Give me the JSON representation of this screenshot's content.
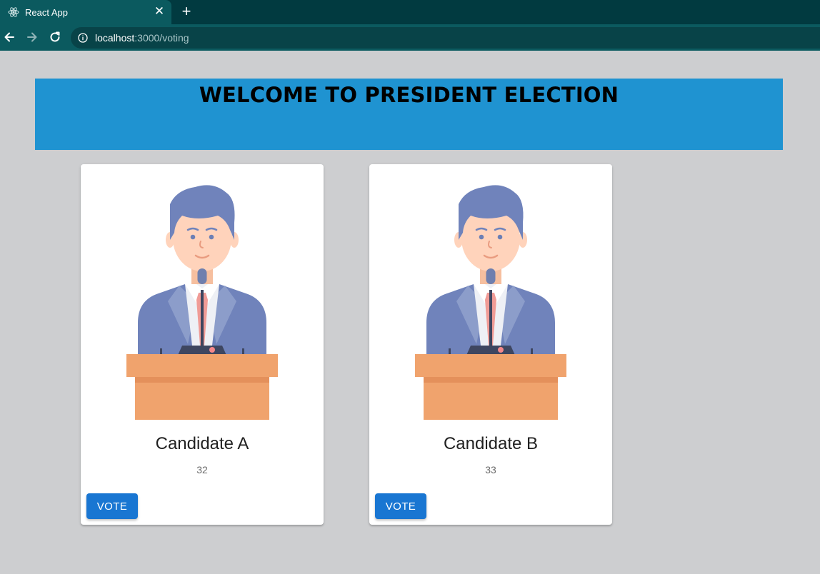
{
  "browser": {
    "tab_title": "React App",
    "tab_icon": "react-logo-icon",
    "url_host": "localhost",
    "url_path": ":3000/voting"
  },
  "header": {
    "title": "WELCOME TO PRESIDENT ELECTION",
    "background": "#1f93d1"
  },
  "candidates": [
    {
      "name": "Candidate A",
      "votes": "32",
      "button_label": "VOTE",
      "illustration": "candidate-at-podium-icon"
    },
    {
      "name": "Candidate B",
      "votes": "33",
      "button_label": "VOTE",
      "illustration": "candidate-at-podium-icon"
    }
  ],
  "colors": {
    "button": "#1976d2",
    "page_background": "#cdced0"
  }
}
